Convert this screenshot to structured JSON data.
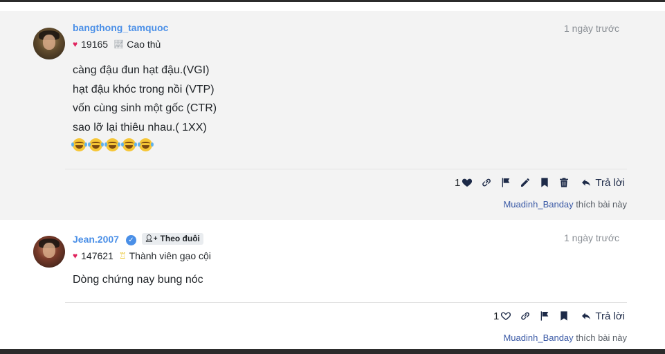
{
  "posts": [
    {
      "username": "bangthong_tamquoc",
      "points": "19165",
      "rank": "Cao thủ",
      "time": "1 ngày trước",
      "lines": [
        "càng đậu đun hạt đậu.(VGI)",
        "hạt đậu khóc trong nồi (VTP)",
        "vốn cùng sinh một gốc (CTR)",
        "sao lỡ lại thiêu nhau.( 1XX)"
      ],
      "emoji": [
        "joy-emoji",
        "joy-emoji",
        "joy-emoji",
        "joy-emoji",
        "joy-emoji"
      ],
      "like_count": "1",
      "reply_label": "Trả lời",
      "liker": "Muadinh_Banday",
      "likes_suffix": " thích bài này"
    },
    {
      "username": "Jean.2007",
      "verified": true,
      "follow_label": "Theo đuôi",
      "points": "147621",
      "rank": "Thành viên gạo cội",
      "time": "1 ngày trước",
      "lines": [
        "Dòng chứng nay bung nóc"
      ],
      "like_count": "1",
      "reply_label": "Trả lời",
      "liker": "Muadinh_Banday",
      "likes_suffix": " thích bài này"
    }
  ],
  "icons": {
    "heart": "heart-icon",
    "link": "link-icon",
    "flag": "flag-icon",
    "edit": "pencil-icon",
    "bookmark": "bookmark-icon",
    "delete": "trash-icon",
    "reply": "reply-icon"
  },
  "colors": {
    "username": "#4a8fe7",
    "heart": "#e0245e",
    "action": "#1d2a48",
    "post_alt_bg": "#f3f3f3"
  }
}
